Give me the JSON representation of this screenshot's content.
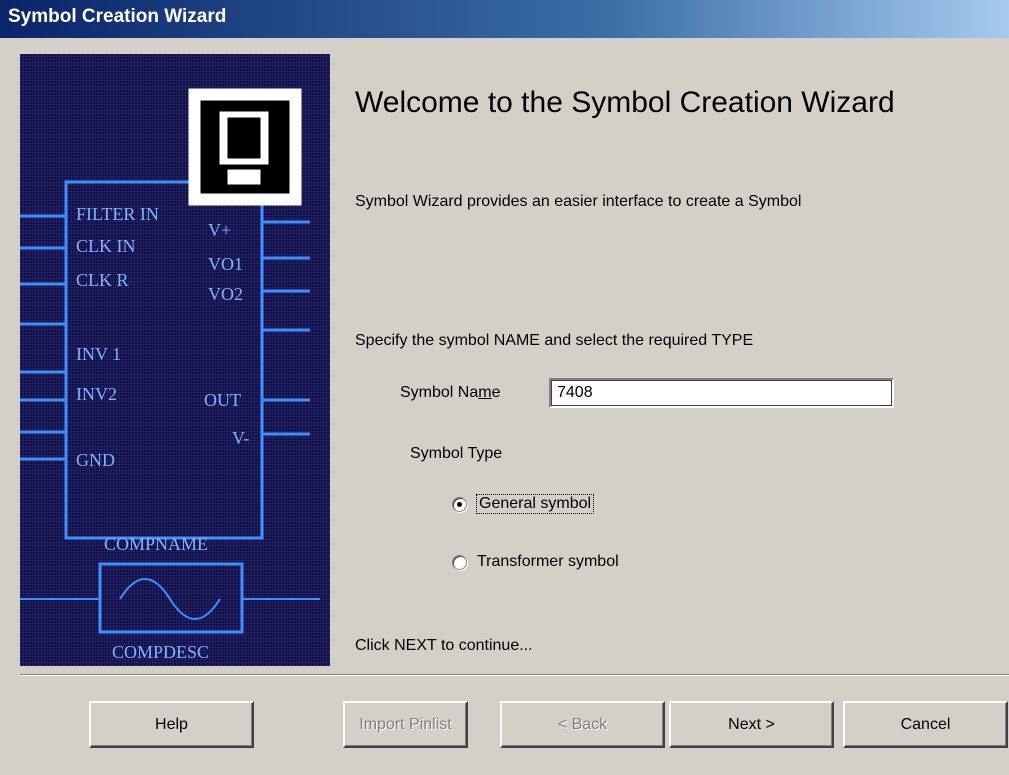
{
  "window": {
    "title": "Symbol Creation Wizard"
  },
  "illustration": {
    "pins_left": [
      "FILTER IN",
      "CLK IN",
      "CLK R",
      "INV 1",
      "INV2",
      "GND"
    ],
    "pins_right": [
      "V+",
      "VO1",
      "VO2",
      "OUT",
      "V-"
    ],
    "comp_name": "COMPNAME",
    "comp_desc": "COMPDESC",
    "panel_color": "#10104e",
    "line_color": "#3f8fff"
  },
  "main": {
    "title": "Welcome to the Symbol Creation Wizard",
    "intro": "Symbol Wizard provides an easier interface to create a Symbol",
    "instruction": "Specify the  symbol NAME and select the required TYPE",
    "name_label": "Symbol Name",
    "name_value": "7408",
    "type_label": "Symbol Type",
    "options": [
      {
        "label": "General symbol",
        "selected": true
      },
      {
        "label": "Transformer symbol",
        "selected": false
      }
    ],
    "next_hint": "Click NEXT to continue..."
  },
  "buttons": {
    "help": "Help",
    "import": "Import Pinlist",
    "back": "< Back",
    "next": "Next >",
    "cancel": "Cancel"
  }
}
